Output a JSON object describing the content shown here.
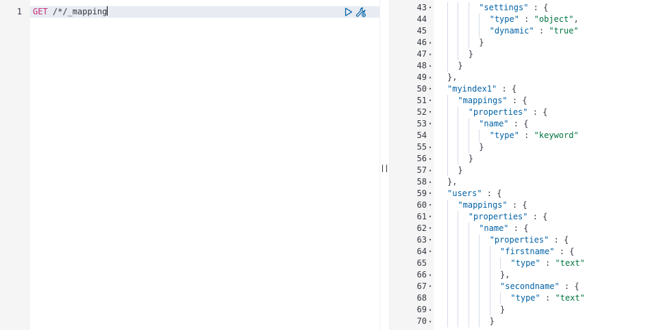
{
  "request": {
    "line_number": "1",
    "method": "GET",
    "path": " /*/_mapping",
    "run_icon": "play-icon",
    "settings_icon": "wrench-icon"
  },
  "resizer": {
    "grip_icon": "drag-handle-icon"
  },
  "response": {
    "lines": [
      {
        "num": "43",
        "fold": "▾",
        "indent": 3,
        "parts": [
          [
            "key",
            "\"settings\""
          ],
          [
            "punc",
            " : {"
          ]
        ]
      },
      {
        "num": "44",
        "fold": "",
        "indent": 4,
        "parts": [
          [
            "key",
            "\"type\""
          ],
          [
            "punc",
            " : "
          ],
          [
            "str",
            "\"object\""
          ],
          [
            "punc",
            ","
          ]
        ]
      },
      {
        "num": "45",
        "fold": "",
        "indent": 4,
        "parts": [
          [
            "key",
            "\"dynamic\""
          ],
          [
            "punc",
            " : "
          ],
          [
            "str",
            "\"true\""
          ]
        ]
      },
      {
        "num": "46",
        "fold": "▴",
        "indent": 3,
        "parts": [
          [
            "punc",
            "}"
          ]
        ]
      },
      {
        "num": "47",
        "fold": "▴",
        "indent": 2,
        "parts": [
          [
            "punc",
            "}"
          ]
        ]
      },
      {
        "num": "48",
        "fold": "▴",
        "indent": 1,
        "parts": [
          [
            "punc",
            "}"
          ]
        ]
      },
      {
        "num": "49",
        "fold": "▴",
        "indent": 0,
        "parts": [
          [
            "punc",
            "},"
          ]
        ]
      },
      {
        "num": "50",
        "fold": "▾",
        "indent": 0,
        "parts": [
          [
            "key",
            "\"myindex1\""
          ],
          [
            "punc",
            " : {"
          ]
        ]
      },
      {
        "num": "51",
        "fold": "▾",
        "indent": 1,
        "parts": [
          [
            "key",
            "\"mappings\""
          ],
          [
            "punc",
            " : {"
          ]
        ]
      },
      {
        "num": "52",
        "fold": "▾",
        "indent": 2,
        "parts": [
          [
            "key",
            "\"properties\""
          ],
          [
            "punc",
            " : {"
          ]
        ]
      },
      {
        "num": "53",
        "fold": "▾",
        "indent": 3,
        "parts": [
          [
            "key",
            "\"name\""
          ],
          [
            "punc",
            " : {"
          ]
        ]
      },
      {
        "num": "54",
        "fold": "",
        "indent": 4,
        "parts": [
          [
            "key",
            "\"type\""
          ],
          [
            "punc",
            " : "
          ],
          [
            "str",
            "\"keyword\""
          ]
        ]
      },
      {
        "num": "55",
        "fold": "▴",
        "indent": 3,
        "parts": [
          [
            "punc",
            "}"
          ]
        ]
      },
      {
        "num": "56",
        "fold": "▴",
        "indent": 2,
        "parts": [
          [
            "punc",
            "}"
          ]
        ]
      },
      {
        "num": "57",
        "fold": "▴",
        "indent": 1,
        "parts": [
          [
            "punc",
            "}"
          ]
        ]
      },
      {
        "num": "58",
        "fold": "▴",
        "indent": 0,
        "parts": [
          [
            "punc",
            "},"
          ]
        ]
      },
      {
        "num": "59",
        "fold": "▾",
        "indent": 0,
        "parts": [
          [
            "key",
            "\"users\""
          ],
          [
            "punc",
            " : {"
          ]
        ]
      },
      {
        "num": "60",
        "fold": "▾",
        "indent": 1,
        "parts": [
          [
            "key",
            "\"mappings\""
          ],
          [
            "punc",
            " : {"
          ]
        ]
      },
      {
        "num": "61",
        "fold": "▾",
        "indent": 2,
        "parts": [
          [
            "key",
            "\"properties\""
          ],
          [
            "punc",
            " : {"
          ]
        ]
      },
      {
        "num": "62",
        "fold": "▾",
        "indent": 3,
        "parts": [
          [
            "key",
            "\"name\""
          ],
          [
            "punc",
            " : {"
          ]
        ]
      },
      {
        "num": "63",
        "fold": "▾",
        "indent": 4,
        "parts": [
          [
            "key",
            "\"properties\""
          ],
          [
            "punc",
            " : {"
          ]
        ]
      },
      {
        "num": "64",
        "fold": "▾",
        "indent": 5,
        "parts": [
          [
            "key",
            "\"firstname\""
          ],
          [
            "punc",
            " : {"
          ]
        ]
      },
      {
        "num": "65",
        "fold": "",
        "indent": 6,
        "parts": [
          [
            "key",
            "\"type\""
          ],
          [
            "punc",
            " : "
          ],
          [
            "str",
            "\"text\""
          ]
        ]
      },
      {
        "num": "66",
        "fold": "▴",
        "indent": 5,
        "parts": [
          [
            "punc",
            "},"
          ]
        ]
      },
      {
        "num": "67",
        "fold": "▾",
        "indent": 5,
        "parts": [
          [
            "key",
            "\"secondname\""
          ],
          [
            "punc",
            " : {"
          ]
        ]
      },
      {
        "num": "68",
        "fold": "",
        "indent": 6,
        "parts": [
          [
            "key",
            "\"type\""
          ],
          [
            "punc",
            " : "
          ],
          [
            "str",
            "\"text\""
          ]
        ]
      },
      {
        "num": "69",
        "fold": "▴",
        "indent": 5,
        "parts": [
          [
            "punc",
            "}"
          ]
        ]
      },
      {
        "num": "70",
        "fold": "▴",
        "indent": 4,
        "parts": [
          [
            "punc",
            "}"
          ]
        ]
      }
    ]
  },
  "colors": {
    "method": "#c42775",
    "key": "#0061a6",
    "string": "#00753f",
    "text": "#343741",
    "gutter": "#f5f5f5",
    "active_line": "#e8ecf2",
    "indent_guide": "#d3dae6"
  }
}
